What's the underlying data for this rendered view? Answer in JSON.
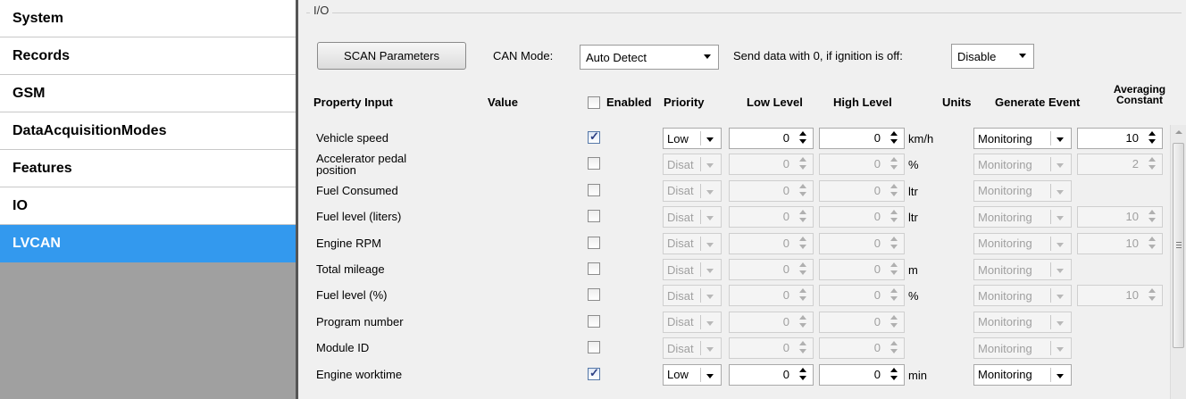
{
  "sidebar": {
    "items": [
      {
        "label": "System"
      },
      {
        "label": "Records"
      },
      {
        "label": "GSM"
      },
      {
        "label": "DataAcquisitionModes"
      },
      {
        "label": "Features"
      },
      {
        "label": "IO"
      },
      {
        "label": "LVCAN",
        "active": true
      }
    ]
  },
  "group": {
    "title": "I/O"
  },
  "toolbar": {
    "scan_label": "SCAN Parameters",
    "can_mode_label": "CAN Mode:",
    "can_mode_value": "Auto Detect",
    "send_zero_label": "Send data with 0, if ignition is off:",
    "send_zero_value": "Disable"
  },
  "table": {
    "headers": {
      "property": "Property Input",
      "value": "Value",
      "enabled": "Enabled",
      "priority": "Priority",
      "low": "Low Level",
      "high": "High Level",
      "units": "Units",
      "event": "Generate Event",
      "averaging_1": "Averaging",
      "averaging_2": "Constant"
    },
    "rows": [
      {
        "name": "Vehicle speed",
        "enabled": true,
        "priority": "Low",
        "low": "0",
        "high": "0",
        "unit": "km/h",
        "event": "Monitoring",
        "avg": "10"
      },
      {
        "name": "Accelerator pedal position",
        "enabled": false,
        "priority": "Disat",
        "low": "0",
        "high": "0",
        "unit": "%",
        "event": "Monitoring",
        "avg": "2"
      },
      {
        "name": "Fuel Consumed",
        "enabled": false,
        "priority": "Disat",
        "low": "0",
        "high": "0",
        "unit": "ltr",
        "event": "Monitoring",
        "avg": ""
      },
      {
        "name": "Fuel level (liters)",
        "enabled": false,
        "priority": "Disat",
        "low": "0",
        "high": "0",
        "unit": "ltr",
        "event": "Monitoring",
        "avg": "10"
      },
      {
        "name": "Engine RPM",
        "enabled": false,
        "priority": "Disat",
        "low": "0",
        "high": "0",
        "unit": "",
        "event": "Monitoring",
        "avg": "10"
      },
      {
        "name": "Total mileage",
        "enabled": false,
        "priority": "Disat",
        "low": "0",
        "high": "0",
        "unit": "m",
        "event": "Monitoring",
        "avg": ""
      },
      {
        "name": "Fuel level (%)",
        "enabled": false,
        "priority": "Disat",
        "low": "0",
        "high": "0",
        "unit": "%",
        "event": "Monitoring",
        "avg": "10"
      },
      {
        "name": "Program number",
        "enabled": false,
        "priority": "Disat",
        "low": "0",
        "high": "0",
        "unit": "",
        "event": "Monitoring",
        "avg": ""
      },
      {
        "name": "Module ID",
        "enabled": false,
        "priority": "Disat",
        "low": "0",
        "high": "0",
        "unit": "",
        "event": "Monitoring",
        "avg": ""
      },
      {
        "name": "Engine worktime",
        "enabled": true,
        "priority": "Low",
        "low": "0",
        "high": "0",
        "unit": "min",
        "event": "Monitoring",
        "avg": ""
      }
    ]
  }
}
